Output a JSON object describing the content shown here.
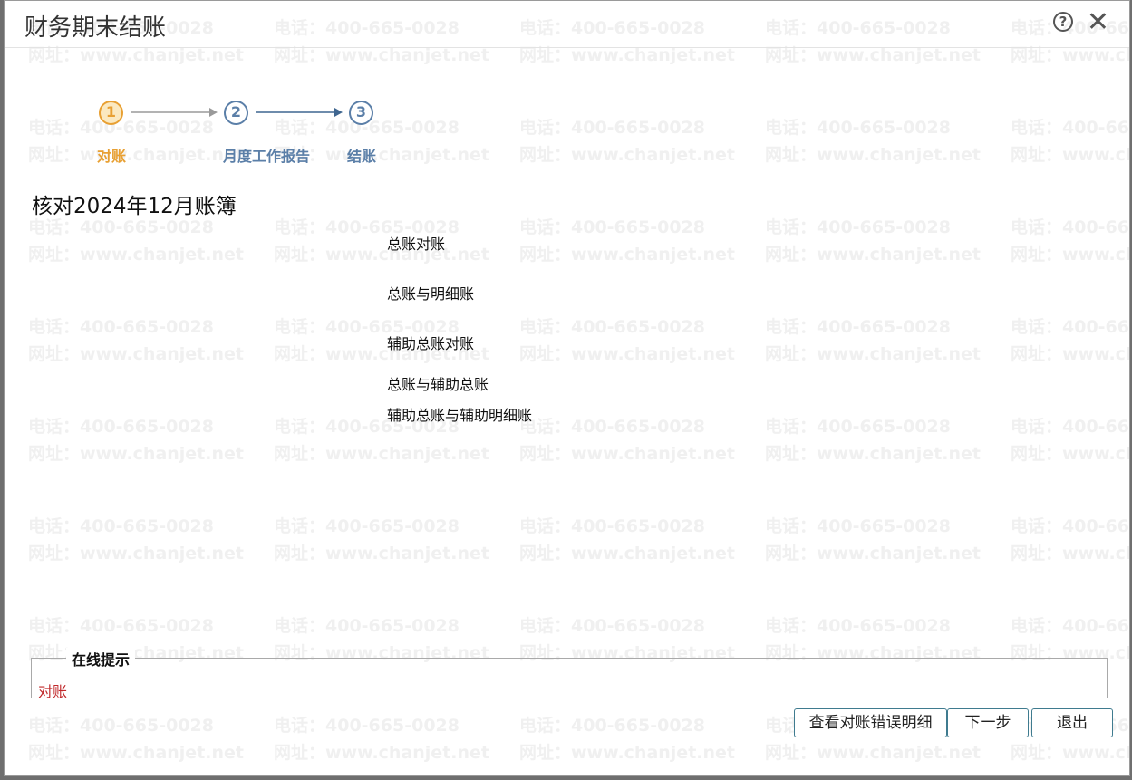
{
  "dialog": {
    "title": "财务期末结账",
    "help_icon": "question-circle-icon",
    "close_icon": "close-x-icon"
  },
  "watermark": {
    "line1": "电话：400-665-0028",
    "line2": "网址：www.chanjet.net"
  },
  "steps": [
    {
      "number": "1",
      "label": "对账",
      "state": "active"
    },
    {
      "number": "2",
      "label": "月度工作报告",
      "state": "pending"
    },
    {
      "number": "3",
      "label": "结账",
      "state": "pending"
    }
  ],
  "heading": "核对2024年12月账簿",
  "check_items": [
    "总账对账",
    "总账与明细账",
    "辅助总账对账",
    "总账与辅助总账",
    "辅助总账与辅助明细账"
  ],
  "online_tip": {
    "title": "在线提示",
    "text": "对账"
  },
  "buttons": {
    "view_errors": "查看对账错误明细",
    "next": "下一步",
    "exit": "退出"
  },
  "colors": {
    "active_step": "#e8a033",
    "pending_step": "#5b7fa8",
    "tip_text": "#c0282a",
    "button_border": "#3f7b8f"
  }
}
